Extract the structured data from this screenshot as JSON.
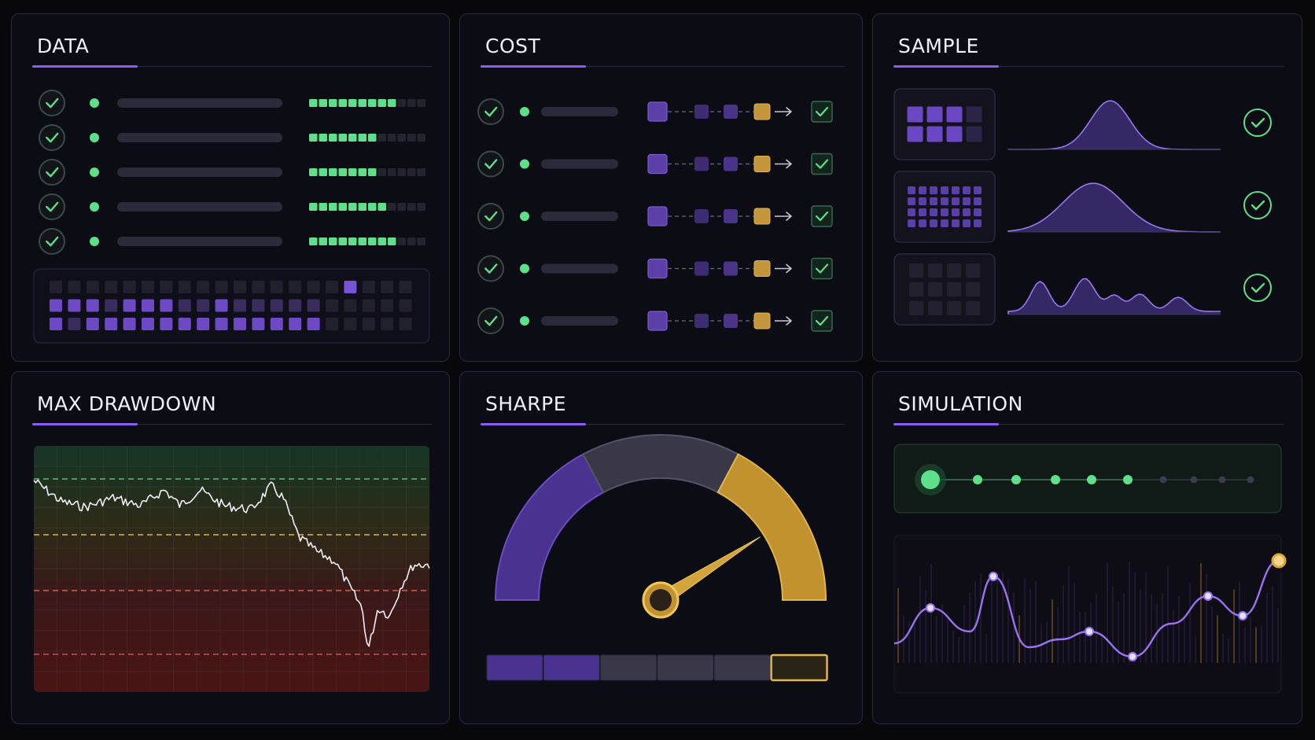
{
  "panels": {
    "data": {
      "title": "DATA",
      "rows": [
        {
          "status": "ok",
          "fill": 0.74
        },
        {
          "status": "ok",
          "fill": 0.6
        },
        {
          "status": "ok",
          "fill": 0.58
        },
        {
          "status": "ok",
          "fill": 0.66
        },
        {
          "status": "ok",
          "fill": 0.72
        }
      ],
      "grid_rows": [
        [
          0,
          0,
          0,
          0,
          0,
          0,
          0,
          0,
          0,
          0,
          0,
          0,
          0,
          0,
          0,
          0,
          1,
          0,
          0,
          0
        ],
        [
          1,
          1,
          1,
          0,
          1,
          1,
          1,
          0,
          0,
          1,
          0,
          0,
          0,
          0,
          0,
          0,
          0,
          0,
          0,
          0
        ],
        [
          1,
          0,
          1,
          1,
          1,
          1,
          1,
          1,
          1,
          1,
          1,
          1,
          1,
          1,
          1,
          0,
          0,
          0,
          0,
          0
        ]
      ]
    },
    "cost": {
      "title": "COST",
      "rows": 5
    },
    "sample": {
      "title": "SAMPLE",
      "rows": [
        {
          "thumb": "4x2",
          "curve": "bell-narrow",
          "status": "ok"
        },
        {
          "thumb": "7x4",
          "curve": "bell-wide",
          "status": "ok"
        },
        {
          "thumb": "4x3-dim",
          "curve": "multi-modal",
          "status": "ok"
        }
      ]
    },
    "drawdown": {
      "title": "MAX DRAWDOWN"
    },
    "sharpe": {
      "title": "SHARPE",
      "gauge_value": 0.82,
      "segments": 6,
      "active_segment": 6
    },
    "simulation": {
      "title": "SIMULATION",
      "steps_total": 10,
      "steps_done": 6
    }
  },
  "colors": {
    "green": "#5ee08a",
    "purple": "#7a52d6",
    "gold": "#d8a73a",
    "red": "#e06060",
    "yellow": "#e0c24a"
  }
}
